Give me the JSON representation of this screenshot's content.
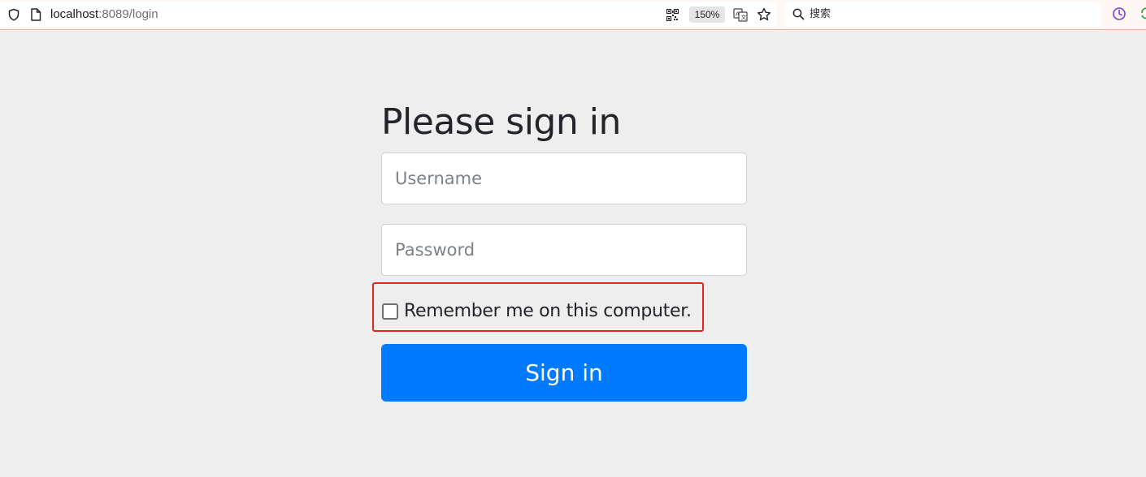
{
  "browser": {
    "url_host": "localhost",
    "url_rest": ":8089/login",
    "zoom_level": "150%",
    "search_placeholder": "搜索",
    "icons": {
      "shield": "shield-icon",
      "page": "page-icon",
      "qr": "qr-code-icon",
      "translate": "translate-icon",
      "bookmark": "star-icon",
      "search": "search-icon",
      "history": "history-icon"
    }
  },
  "login": {
    "heading": "Please sign in",
    "username_placeholder": "Username",
    "username_value": "",
    "password_placeholder": "Password",
    "password_value": "",
    "remember_label": "Remember me on this computer.",
    "remember_checked": false,
    "signin_label": "Sign in"
  },
  "colors": {
    "page_background": "#eeeeee",
    "primary_button": "#007bff",
    "highlight_box": "#e0271d",
    "heading_text": "#212529"
  }
}
